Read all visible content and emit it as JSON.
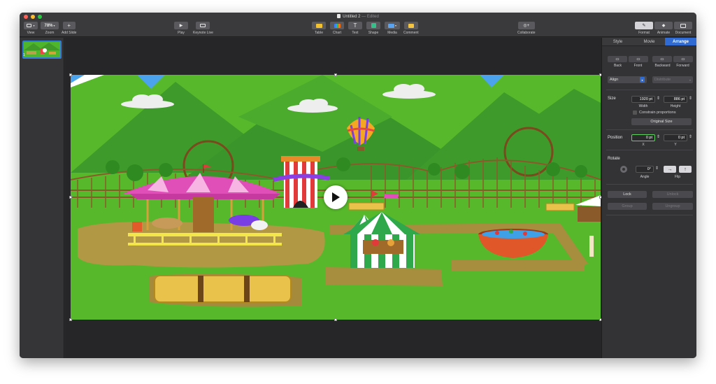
{
  "window": {
    "title": "Untitled 2",
    "title_suffix": " — Edited"
  },
  "toolbar": {
    "view_label": "View",
    "zoom_value": "78%",
    "zoom_label": "Zoom",
    "add_slide_label": "Add Slide",
    "play_label": "Play",
    "keynote_live_label": "Keynote Live",
    "table_label": "Table",
    "chart_label": "Chart",
    "text_label": "Text",
    "shape_label": "Shape",
    "media_label": "Media",
    "comment_label": "Comment",
    "collaborate_label": "Collaborate",
    "format_label": "Format",
    "animate_label": "Animate",
    "document_label": "Document"
  },
  "slides": [
    {
      "number": "1"
    }
  ],
  "inspector": {
    "tabs": [
      "Style",
      "Movie",
      "Arrange"
    ],
    "active_tab": "Arrange",
    "back_label": "Back",
    "front_label": "Front",
    "backward_label": "Backward",
    "forward_label": "Forward",
    "align_label": "Align",
    "distribute_label": "Distribute",
    "size_label": "Size",
    "width_value": "1920 pt",
    "width_label": "Width",
    "height_value": "886 pt",
    "height_label": "Height",
    "constrain_label": "Constrain proportions",
    "original_size_label": "Original Size",
    "position_label": "Position",
    "x_value": "0 pt",
    "x_label": "X",
    "y_value": "0 pt",
    "y_label": "Y",
    "rotate_label": "Rotate",
    "angle_value": "0°",
    "angle_label": "Angle",
    "flip_label": "Flip",
    "lock_label": "Lock",
    "unlock_label": "Unlock",
    "group_label": "Group",
    "ungroup_label": "Ungroup"
  },
  "colors": {
    "accent": "#2f6bd3",
    "grass": "#56b82a",
    "mountain": "#3f9a2a"
  }
}
